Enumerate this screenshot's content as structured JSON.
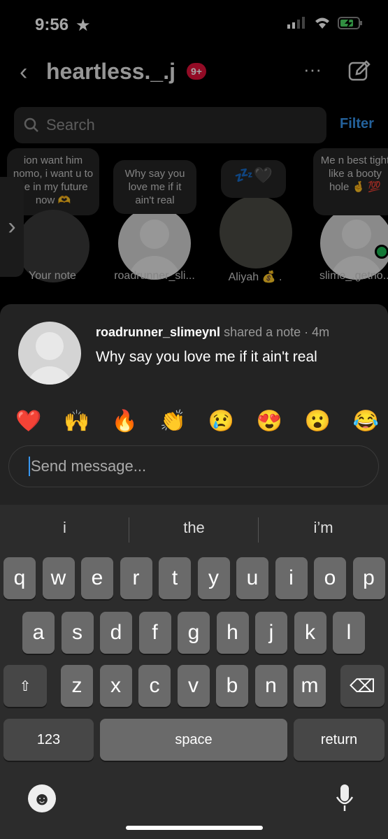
{
  "status": {
    "time": "9:56"
  },
  "header": {
    "title": "heartless._.j",
    "badge": "9+"
  },
  "search": {
    "placeholder": "Search",
    "filter": "Filter"
  },
  "notes": [
    {
      "label": "Your note",
      "text": "ion want him nomo, i want u to be in my future now 🫶"
    },
    {
      "label": "roadrunner_sli...",
      "text": "Why say you love me if it ain't real"
    },
    {
      "label": "Aliyah 💰 .",
      "text": "💤🖤"
    },
    {
      "label": "slime_.getno...",
      "text": "Me n best tight like a booty hole 🤞 💯"
    }
  ],
  "sheet": {
    "username": "roadrunner_slimeynl",
    "meta": "shared a note · 4m",
    "note": "Why say you love me if it ain't real",
    "reactions": [
      "❤️",
      "🙌",
      "🔥",
      "👏",
      "😢",
      "😍",
      "😮",
      "😂"
    ],
    "input_placeholder": "Send message..."
  },
  "keyboard": {
    "suggestions": [
      "i",
      "the",
      "i’m"
    ],
    "row1": [
      "q",
      "w",
      "e",
      "r",
      "t",
      "y",
      "u",
      "i",
      "o",
      "p"
    ],
    "row2": [
      "a",
      "s",
      "d",
      "f",
      "g",
      "h",
      "j",
      "k",
      "l"
    ],
    "row3": [
      "z",
      "x",
      "c",
      "v",
      "b",
      "n",
      "m"
    ],
    "numbers": "123",
    "space": "space",
    "return": "return"
  },
  "colors": {
    "accent": "#3897f0",
    "badge": "#e0123a",
    "online": "#1db954"
  }
}
